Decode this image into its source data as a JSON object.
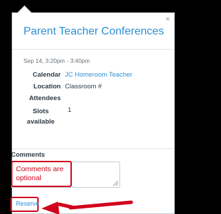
{
  "popup": {
    "close_glyph": "×",
    "title": "Parent Teacher Conferences",
    "datetime": "Sep 14, 3:20pm - 3:40pm",
    "calendar": {
      "label": "Calendar",
      "value": "JC Homeroom Teacher"
    },
    "location": {
      "label": "Location",
      "value": "Classroom #"
    },
    "attendees": {
      "label": "Attendees"
    },
    "slots": {
      "label": "Slots available",
      "value": "1"
    },
    "comments": {
      "label": "Comments",
      "value": ""
    },
    "reserve_label": "Reserve"
  },
  "annotation": {
    "callout_text": "Comments are optional"
  },
  "colors": {
    "accent": "#2d8fd5",
    "annotation": "#d0021b",
    "background": "#000000"
  }
}
